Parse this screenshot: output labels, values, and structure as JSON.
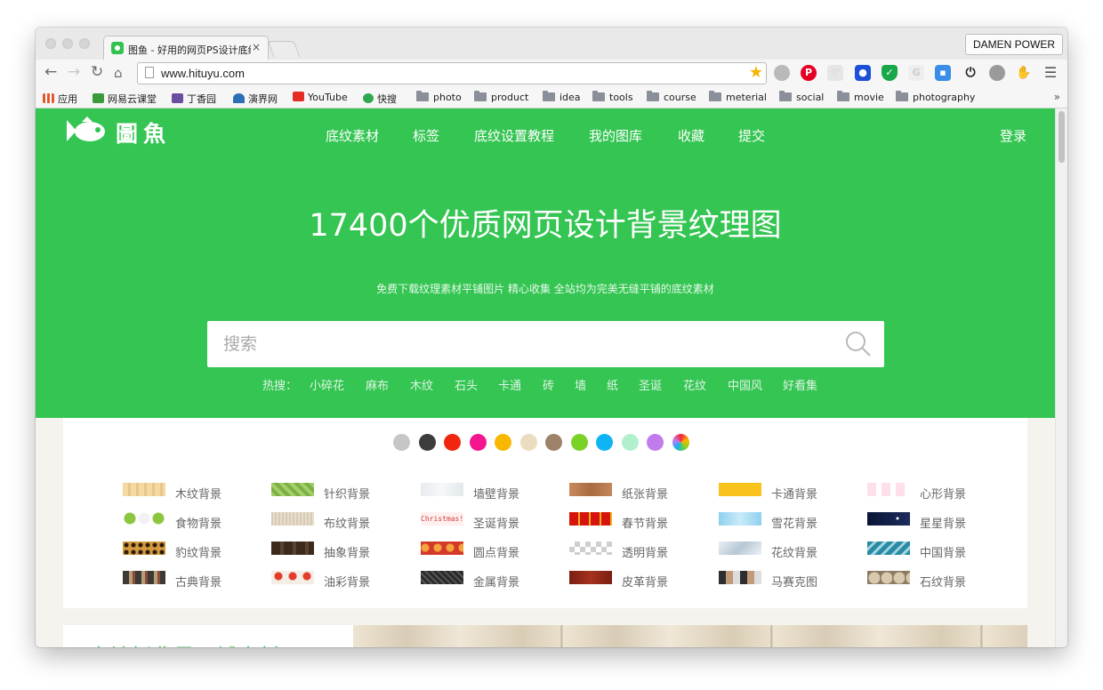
{
  "browser": {
    "tab_title": "图鱼 - 好用的网页PS设计底纹",
    "tab_close": "×",
    "profile": "DAMEN POWER",
    "url": "www.hituyu.com",
    "bookmarks": [
      {
        "label": "应用",
        "icon": "apps-grid-icon",
        "color": "#e3572f"
      },
      {
        "label": "网易云课堂",
        "icon": "netease-study-icon",
        "color": "#3a9b3a"
      },
      {
        "label": "丁香园",
        "icon": "dxy-icon",
        "color": "#6b4ea0"
      },
      {
        "label": "演界网",
        "icon": "yanjie-icon",
        "color": "#2b6fb7"
      },
      {
        "label": "YouTube",
        "icon": "youtube-icon",
        "color": "#e52d27"
      },
      {
        "label": "快搜",
        "icon": "kuaisou-icon",
        "color": "#2ea84f"
      },
      {
        "label": "photo",
        "icon": "folder-icon"
      },
      {
        "label": "product",
        "icon": "folder-icon"
      },
      {
        "label": "idea",
        "icon": "folder-icon"
      },
      {
        "label": "tools",
        "icon": "folder-icon"
      },
      {
        "label": "course",
        "icon": "folder-icon"
      },
      {
        "label": "meterial",
        "icon": "folder-icon"
      },
      {
        "label": "social",
        "icon": "folder-icon"
      },
      {
        "label": "movie",
        "icon": "folder-icon"
      },
      {
        "label": "photography",
        "icon": "folder-icon"
      }
    ],
    "more": "»"
  },
  "site": {
    "accent": "#34c552",
    "logo_text": "圖魚",
    "nav": [
      "底纹素材",
      "标签",
      "底纹设置教程",
      "我的图库",
      "收藏",
      "提交"
    ],
    "login": "登录",
    "headline": "17400个优质网页设计背景纹理图",
    "subline": "免费下载纹理素材平铺图片 精心收集 全站均为完美无缝平铺的底纹素材",
    "search_placeholder": "搜索",
    "hot_label": "热搜：",
    "hot_tags": [
      "小碎花",
      "麻布",
      "木纹",
      "石头",
      "卡通",
      "砖",
      "墙",
      "纸",
      "圣诞",
      "花纹",
      "中国风",
      "好看集"
    ],
    "color_dots": [
      "#c6c6c6",
      "#3c3c3c",
      "#f0260f",
      "#f3168f",
      "#f9b700",
      "#ecdcbf",
      "#9c8268",
      "#7bd227",
      "#0fb4f5",
      "#b2f0cd",
      "#c17bed",
      "rainbow"
    ],
    "categories": [
      [
        "木纹背景",
        "针织背景",
        "墙壁背景",
        "纸张背景",
        "卡通背景",
        "心形背景"
      ],
      [
        "食物背景",
        "布纹背景",
        "圣诞背景",
        "春节背景",
        "雪花背景",
        "星星背景"
      ],
      [
        "豹纹背景",
        "抽象背景",
        "圆点背景",
        "透明背景",
        "花纹背景",
        "中国背景"
      ],
      [
        "古典背景",
        "油彩背景",
        "金属背景",
        "皮革背景",
        "马赛克图",
        "石纹背景"
      ]
    ],
    "swatch_texts": {
      "christmas": "Christmas!"
    },
    "bottom_title": "木地板背景平铺素材"
  }
}
